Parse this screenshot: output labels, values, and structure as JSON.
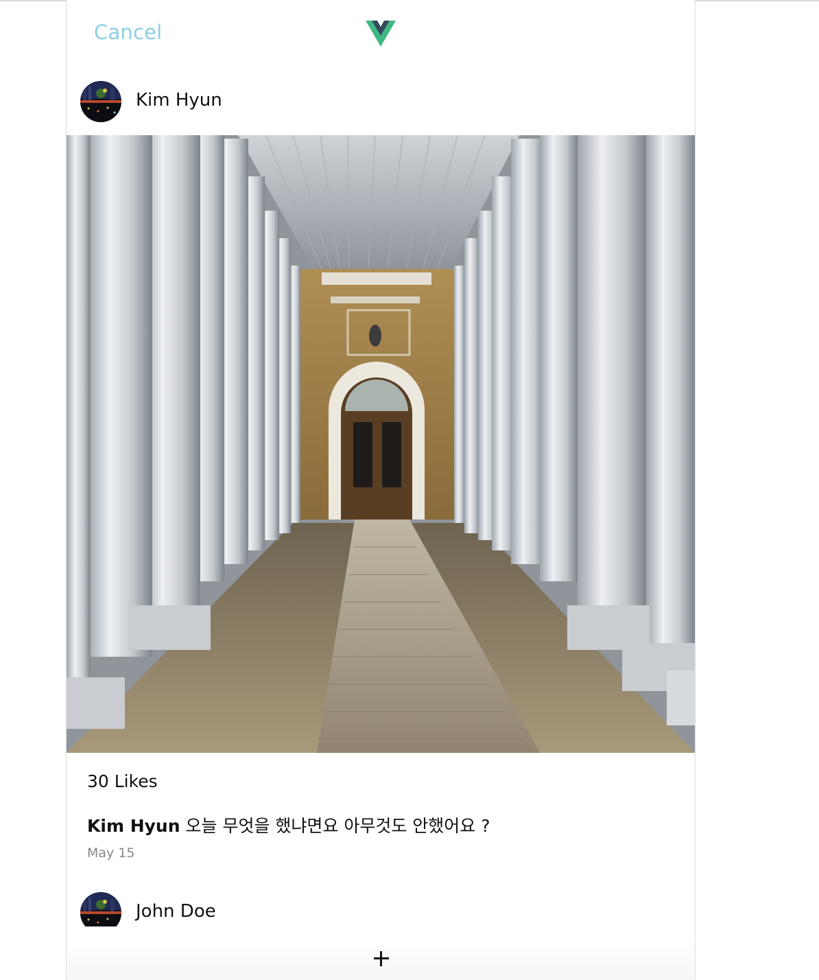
{
  "header": {
    "cancel_label": "Cancel",
    "logo_icon": "vue-logo-icon",
    "logo_colors": {
      "outer": "#41b883",
      "inner": "#35495e"
    },
    "cancel_color": "#8ccfe0"
  },
  "posts": [
    {
      "user_name": "Kim Hyun",
      "avatar_icon": "night-city-avatar",
      "likes": "30 Likes",
      "caption_author": "Kim Hyun",
      "caption_text": "오늘 무엇을 했냐면요 아무것도 안했어요 ?",
      "date": "May 15"
    },
    {
      "user_name": "John Doe",
      "avatar_icon": "night-city-avatar"
    }
  ],
  "footer": {
    "add_icon": "plus-icon"
  }
}
